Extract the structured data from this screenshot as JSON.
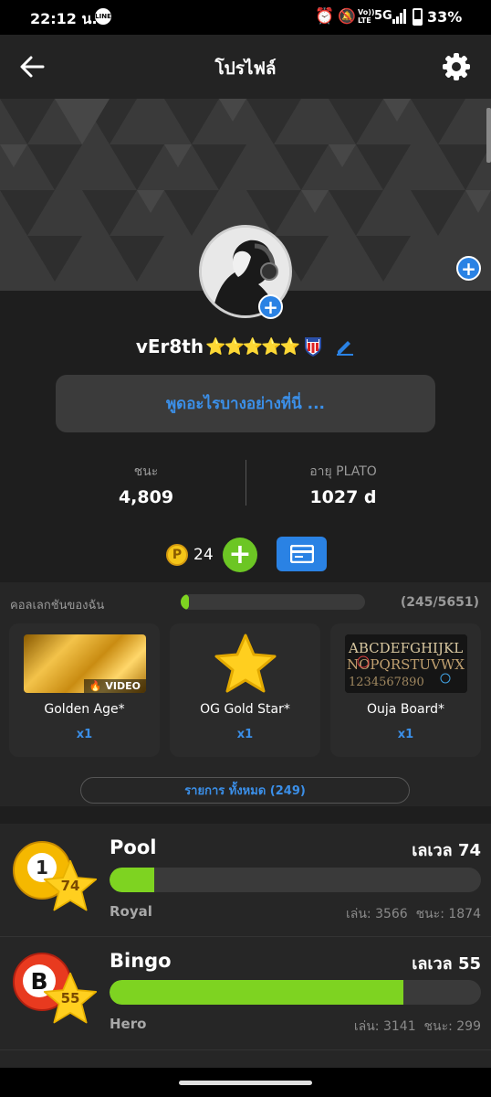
{
  "status_bar": {
    "time": "22:12 น.",
    "battery": "33%",
    "network": "5G",
    "volte": "Vo)) LTE"
  },
  "header": {
    "title": "โปรไฟล์"
  },
  "profile": {
    "username": "vEr8th",
    "stars": "⭐⭐⭐⭐⭐",
    "status_placeholder": "พูดอะไรบางอย่างที่นี่ ..."
  },
  "stats": {
    "wins_label": "ชนะ",
    "wins_value": "4,809",
    "age_label": "อายุ PLATO",
    "age_value": "1027 d"
  },
  "coins": {
    "count": "24"
  },
  "collection": {
    "title": "คอลเลกชันของฉัน",
    "progress_text": "(245/5651)",
    "progress_fraction": 0.043,
    "items": [
      {
        "name": "Golden Age*",
        "qty": "x1",
        "badge": "VIDEO"
      },
      {
        "name": "OG Gold Star*",
        "qty": "x1"
      },
      {
        "name": "Ouja Board*",
        "qty": "x1"
      }
    ],
    "all_button": "รายการ ทั้งหมด (249)"
  },
  "games": [
    {
      "name": "Pool",
      "level_text": "เลเวล 74",
      "badge_level": "74",
      "rank": "Royal",
      "played": "เล่น: 3566",
      "won": "ชนะ: 1874",
      "progress_fraction": 0.12
    },
    {
      "name": "Bingo",
      "level_text": "เลเวล 55",
      "badge_level": "55",
      "rank": "Hero",
      "played": "เล่น: 3141",
      "won": "ชนะ: 299",
      "progress_fraction": 0.79
    }
  ],
  "colors": {
    "accent_blue": "#2a82e4",
    "green": "#7ed321",
    "gold": "#f5c518"
  }
}
